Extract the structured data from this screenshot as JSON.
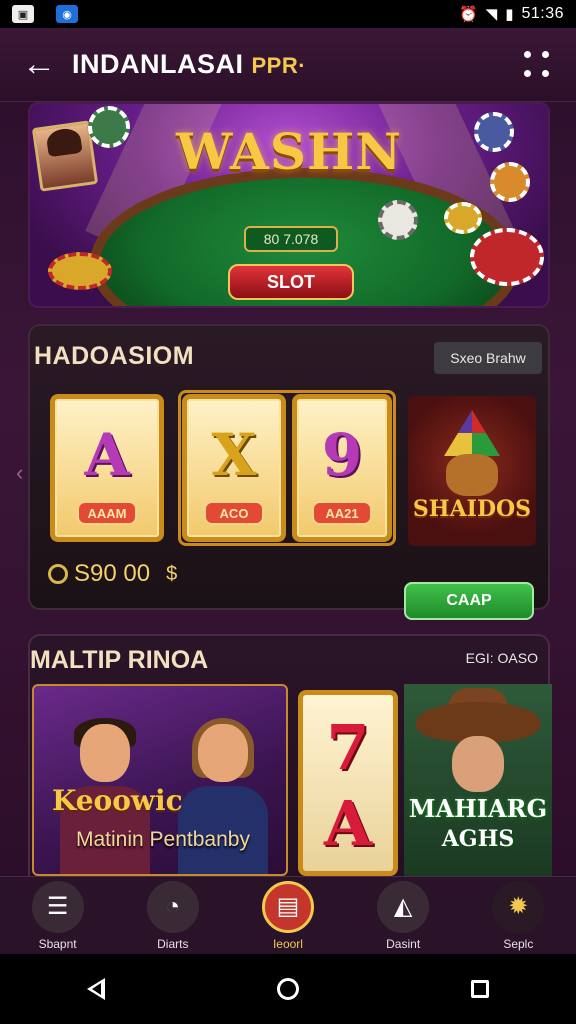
{
  "status_bar": {
    "time": "51:36"
  },
  "top_bar": {
    "title": "INDANLASAI",
    "title_accent": "PPR·"
  },
  "hero": {
    "title": "WASHN",
    "amount": "80 7.078",
    "button_label": "SLOT"
  },
  "section1": {
    "title": "HADOASIOM",
    "top_button": "Sxeo Brahw",
    "reels": [
      {
        "symbol": "A",
        "tag": "AAAM",
        "color": "#b43bb5"
      },
      {
        "symbol": "X",
        "tag": "ACO",
        "color": "#d9a21b"
      },
      {
        "symbol": "9",
        "tag": "AA21",
        "color": "#b43bb5"
      }
    ],
    "balance": "S90 00",
    "balance_suffix": "$",
    "feature_game_label": "SHAIDOS",
    "action_button": "CAAP"
  },
  "section2": {
    "title": "MALTIP RINOA",
    "more_link": "EGI: OASO",
    "tile1": {
      "big_text": "Keoowic",
      "sub_text": "Matinin Pentbanby"
    },
    "tile2": {
      "top_digit": "7",
      "bottom_digit": "A"
    },
    "tile3": {
      "line1": "MAHIARG",
      "line2": "AGHS"
    }
  },
  "bottom_nav": [
    {
      "label": "Sbapnt",
      "icon": "home-icon",
      "active": false
    },
    {
      "label": "Diarts",
      "icon": "chart-icon",
      "active": false
    },
    {
      "label": "Ieoorl",
      "icon": "slot-icon",
      "active": true
    },
    {
      "label": "Dasint",
      "icon": "profile-icon",
      "active": false
    },
    {
      "label": "Seplc",
      "icon": "sun-icon",
      "active": false
    }
  ],
  "colors": {
    "accent_gold": "#f2c94c",
    "accent_red": "#c4352c",
    "accent_green": "#41c24a",
    "background": "#2a0f2a"
  }
}
